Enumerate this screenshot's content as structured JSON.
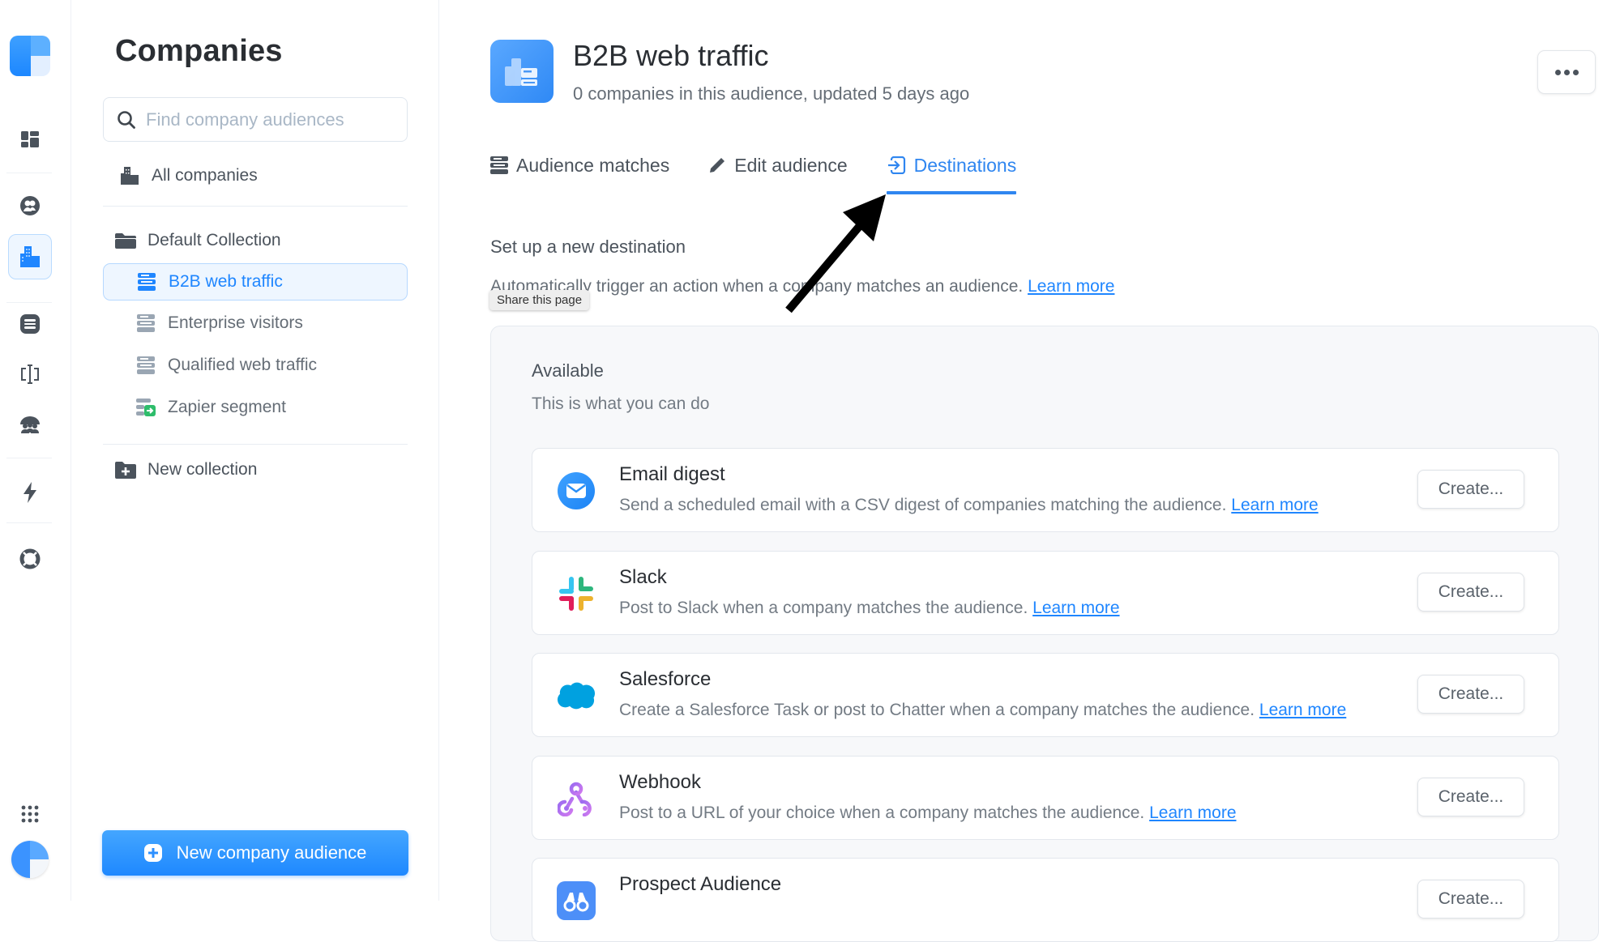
{
  "rail": {
    "items": [
      {
        "icon": "dashboard-icon"
      },
      {
        "icon": "people-icon"
      },
      {
        "icon": "companies-icon",
        "active": true
      },
      {
        "icon": "segments-icon"
      },
      {
        "icon": "text-cursor-icon"
      },
      {
        "icon": "team-icon"
      },
      {
        "icon": "bolt-icon"
      },
      {
        "icon": "lifebuoy-icon"
      },
      {
        "icon": "apps-grid-icon"
      }
    ]
  },
  "panel": {
    "title": "Companies",
    "search_placeholder": "Find company audiences",
    "all_companies": "All companies",
    "collection_name": "Default Collection",
    "audiences": [
      {
        "label": "B2B web traffic",
        "selected": true
      },
      {
        "label": "Enterprise visitors"
      },
      {
        "label": "Qualified web traffic"
      },
      {
        "label": "Zapier segment"
      }
    ],
    "new_collection": "New collection",
    "new_audience_button": "New company audience"
  },
  "header": {
    "title": "B2B web traffic",
    "subtitle": "0 companies in this audience, updated 5 days ago",
    "more_label": "More actions"
  },
  "tabs": [
    {
      "label": "Audience matches",
      "icon": "list-icon"
    },
    {
      "label": "Edit audience",
      "icon": "pencil-icon"
    },
    {
      "label": "Destinations",
      "icon": "destination-icon",
      "active": true
    }
  ],
  "destinations": {
    "section_title": "Set up a new destination",
    "section_desc": "Automatically trigger an action when a company matches an audience.",
    "learn_more": "Learn more",
    "tooltip": "Share this page",
    "available_title": "Available",
    "available_sub": "This is what you can do",
    "items": [
      {
        "title": "Email digest",
        "desc": "Send a scheduled email with a CSV digest of companies matching the audience.",
        "link": "Learn more",
        "button": "Create...",
        "icon": "email-icon"
      },
      {
        "title": "Slack",
        "desc": "Post to Slack when a company matches the audience.",
        "link": "Learn more",
        "button": "Create...",
        "icon": "slack-icon"
      },
      {
        "title": "Salesforce",
        "desc": "Create a Salesforce Task or post to Chatter when a company matches the audience.",
        "link": "Learn more",
        "button": "Create...",
        "icon": "salesforce-icon"
      },
      {
        "title": "Webhook",
        "desc": "Post to a URL of your choice when a company matches the audience.",
        "link": "Learn more",
        "button": "Create...",
        "icon": "webhook-icon"
      },
      {
        "title": "Prospect Audience",
        "desc": "",
        "link": "",
        "button": "Create...",
        "icon": "binoculars-icon"
      }
    ]
  },
  "colors": {
    "accent": "#1f86ff",
    "tab_active": "#2f86f0",
    "text": "#2a2e33",
    "muted": "#737b84"
  }
}
